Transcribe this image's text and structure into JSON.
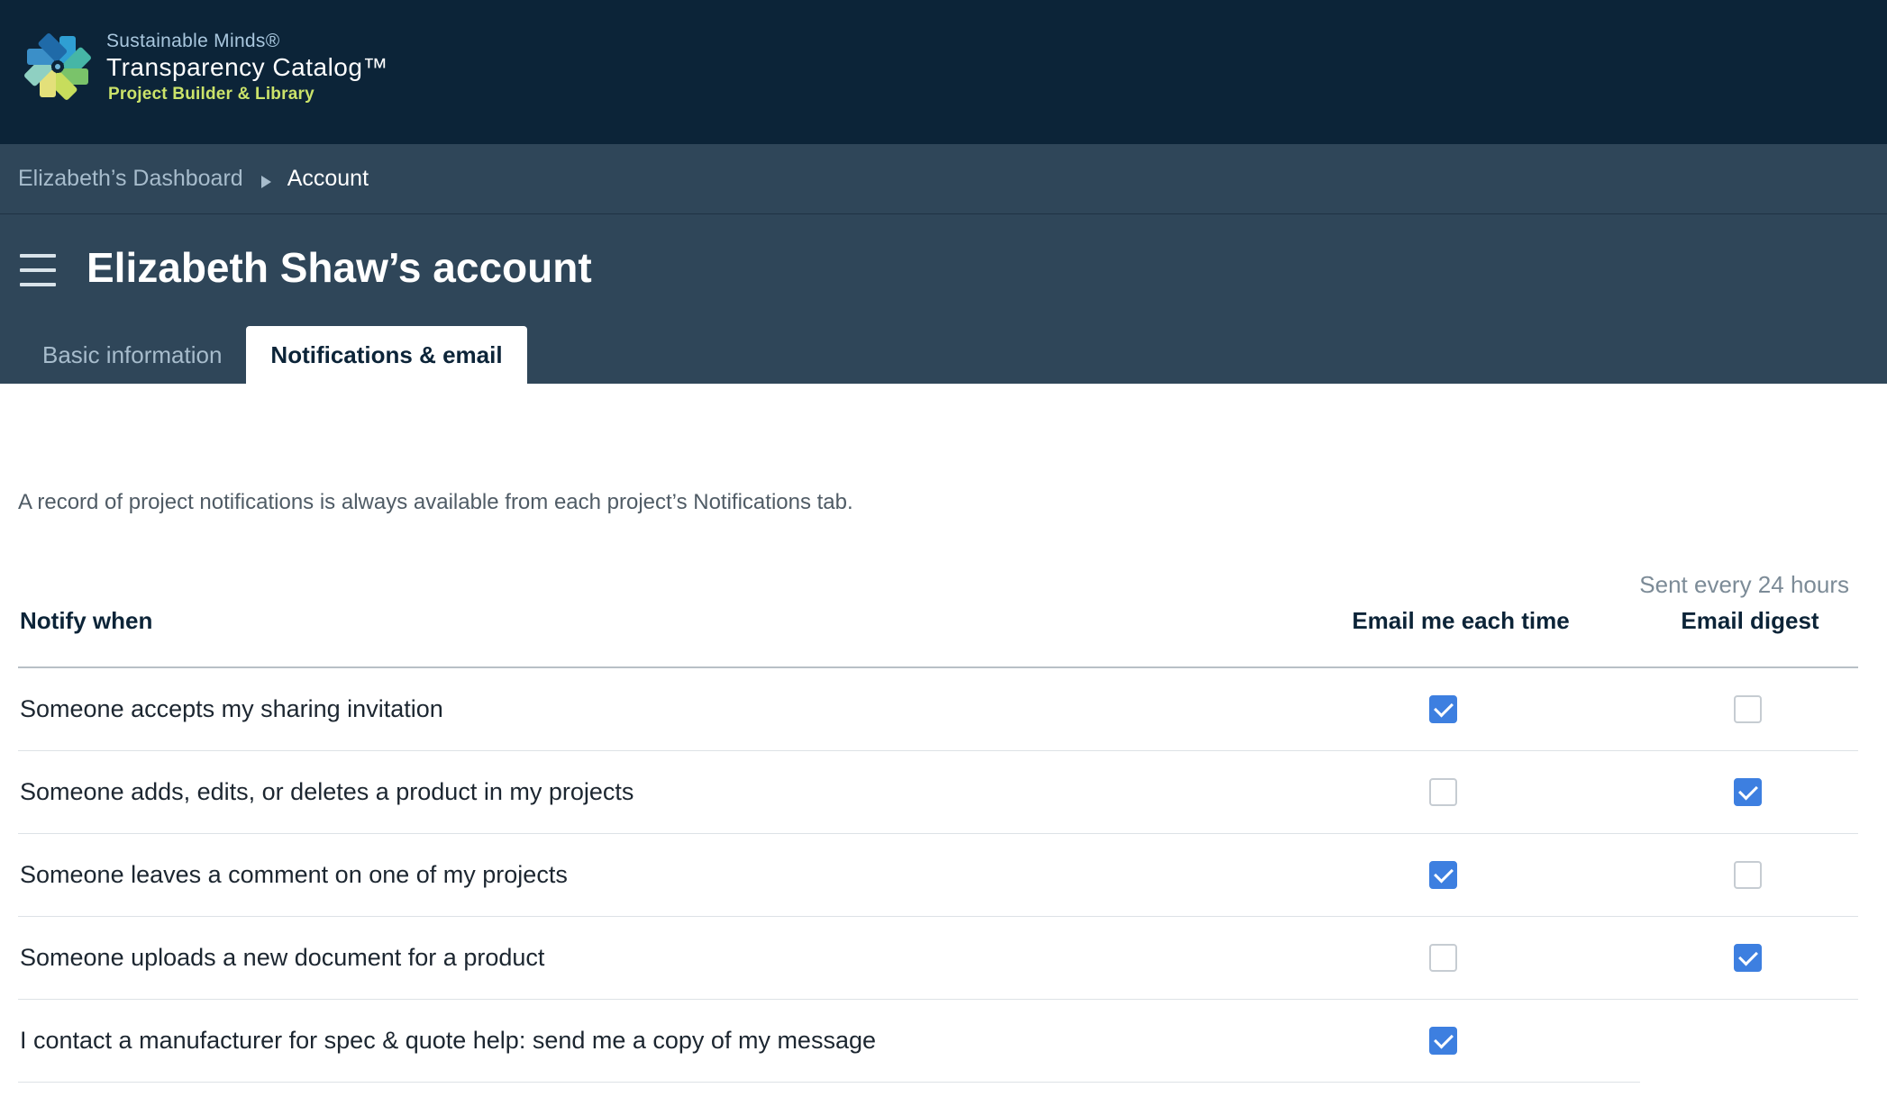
{
  "brand": {
    "line1": "Sustainable Minds®",
    "line2": "Transparency Catalog™",
    "line3": "Project Builder & Library",
    "colors": {
      "header_bg": "#0c2438",
      "band_bg": "#2f4659",
      "accent_green": "#cbe36a",
      "checkbox_blue": "#3d7fe0"
    }
  },
  "breadcrumb": {
    "items": [
      {
        "label": "Elizabeth’s Dashboard"
      },
      {
        "label": "Account"
      }
    ],
    "separator_icon": "triangle-right-icon"
  },
  "header": {
    "menu_icon": "hamburger-menu-icon",
    "title": "Elizabeth Shaw’s account"
  },
  "tabs": [
    {
      "label": "Basic information",
      "active": false
    },
    {
      "label": "Notifications & email",
      "active": true
    }
  ],
  "notifications": {
    "intro": "A record of project notifications is always available from each project’s Notifications tab.",
    "columns": {
      "notify_when": "Notify when",
      "email_each": "Email me each time",
      "email_digest": "Email digest",
      "digest_note": "Sent every 24 hours"
    },
    "rows": [
      {
        "label": "Someone accepts my sharing invitation",
        "email_each": true,
        "email_digest": false
      },
      {
        "label": "Someone adds, edits, or deletes a product in my projects",
        "email_each": false,
        "email_digest": true
      },
      {
        "label": "Someone leaves a comment on one of my projects",
        "email_each": true,
        "email_digest": false
      },
      {
        "label": "Someone uploads a new document for a product",
        "email_each": false,
        "email_digest": true
      },
      {
        "label": "I contact a manufacturer for spec & quote help: send me a copy of my message",
        "email_each": true,
        "email_digest": null
      }
    ]
  }
}
